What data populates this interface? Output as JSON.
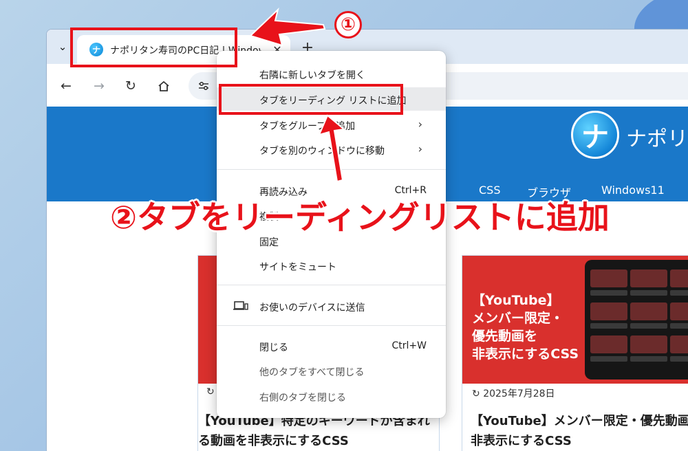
{
  "browser": {
    "tab": {
      "title": "ナポリタン寿司のPC日記 | Window",
      "favicon": "napolitan-logo-icon"
    },
    "icons": {
      "tab_search": "chevron-down-icon",
      "close": "close-icon",
      "new_tab": "plus-icon",
      "back": "back-arrow-icon",
      "forward": "forward-arrow-icon",
      "reload": "reload-icon",
      "home": "home-icon",
      "site_info": "tune-icon"
    }
  },
  "site": {
    "logo_text": "ナポリ",
    "nav": [
      "CSS",
      "ブラウザ",
      "Windows11"
    ],
    "cards": [
      {
        "title": "【YouTube】特定のキーワードが含まれる動画を非表示にするCSS"
      },
      {
        "overlay": [
          "【YouTube】",
          "メンバー限定・",
          "優先動画を",
          "非表示にするCSS"
        ],
        "date": "2025年7月28日",
        "title": "【YouTube】メンバー限定・優先動画を非表示にするCSS"
      }
    ]
  },
  "context_menu": {
    "items": [
      {
        "label": "右隣に新しいタブを開く"
      },
      {
        "label": "タブをリーディング リストに追加",
        "highlighted": true
      },
      {
        "label": "タブをグループに追加",
        "submenu": true
      },
      {
        "label": "タブを別のウィンドウに移動",
        "submenu": true
      },
      {
        "label": "再読み込み",
        "shortcut": "Ctrl+R"
      },
      {
        "label": "複製"
      },
      {
        "label": "固定"
      },
      {
        "label": "サイトをミュート"
      },
      {
        "label": "お使いのデバイスに送信",
        "icon": "device-icon"
      },
      {
        "label": "閉じる",
        "shortcut": "Ctrl+W"
      },
      {
        "label": "他のタブをすべて閉じる"
      },
      {
        "label": "右側のタブを閉じる"
      }
    ]
  },
  "annotations": {
    "step1": "①",
    "step2": "②タブをリーディングリストに追加",
    "color": "#e8121a"
  }
}
